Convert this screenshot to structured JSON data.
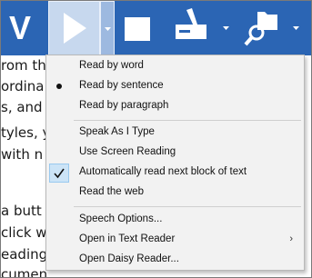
{
  "toolbar": {
    "logo_text": "V",
    "colors": {
      "bar": "#2b65b4",
      "active_button": "#c7d8ee"
    }
  },
  "document_lines": [
    "rom th",
    "ordina",
    "s, and S",
    "tyles, y",
    " with n",
    "",
    "a butt",
    "click wh",
    "eading",
    "cumen"
  ],
  "menu": {
    "items": [
      {
        "label": "Read by word",
        "mark": "none"
      },
      {
        "label": "Read by sentence",
        "mark": "bullet"
      },
      {
        "label": "Read by paragraph",
        "mark": "none"
      },
      {
        "label": "Speak As I Type",
        "mark": "none"
      },
      {
        "label": "Use Screen Reading",
        "mark": "none"
      },
      {
        "label": "Automatically read next block of text",
        "mark": "check"
      },
      {
        "label": "Read the web",
        "mark": "none"
      },
      {
        "label": "Speech Options...",
        "mark": "none"
      },
      {
        "label": "Open in Text Reader",
        "mark": "none",
        "submenu_arrow": "›"
      },
      {
        "label": "Open Daisy Reader...",
        "mark": "none"
      }
    ]
  }
}
